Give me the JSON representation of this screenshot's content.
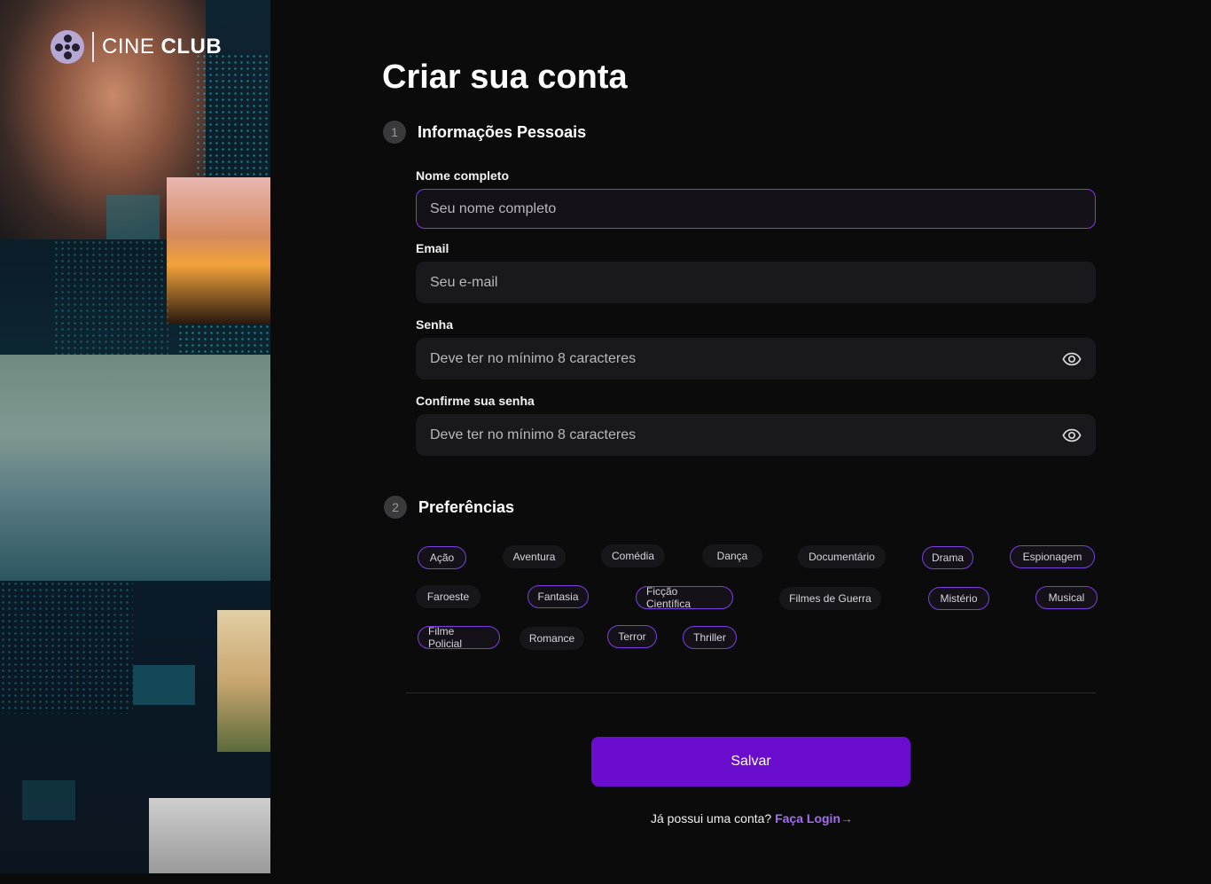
{
  "brand": {
    "light": "CINE",
    "bold": "CLUB"
  },
  "page_title": "Criar sua conta",
  "sections": {
    "personal": {
      "number": "1",
      "title": "Informações Pessoais"
    },
    "preferences": {
      "number": "2",
      "title": "Preferências"
    }
  },
  "fields": {
    "name": {
      "label": "Nome completo",
      "placeholder": "Seu nome completo"
    },
    "email": {
      "label": "Email",
      "placeholder": "Seu e-mail"
    },
    "password": {
      "label": "Senha",
      "placeholder": "Deve ter no mínimo 8 caracteres"
    },
    "confirm": {
      "label": "Confirme sua senha",
      "placeholder": "Deve ter no mínimo 8 caracteres"
    }
  },
  "genres": [
    {
      "label": "Ação",
      "selected": true
    },
    {
      "label": "Aventura",
      "selected": false
    },
    {
      "label": "Comédia",
      "selected": false
    },
    {
      "label": "Dança",
      "selected": false
    },
    {
      "label": "Documentário",
      "selected": false
    },
    {
      "label": "Drama",
      "selected": true
    },
    {
      "label": "Espionagem",
      "selected": true
    },
    {
      "label": "Faroeste",
      "selected": false
    },
    {
      "label": "Fantasia",
      "selected": true
    },
    {
      "label": "Ficção Científica",
      "selected": true
    },
    {
      "label": "Filmes de Guerra",
      "selected": false
    },
    {
      "label": "Mistério",
      "selected": true
    },
    {
      "label": "Musical",
      "selected": true
    },
    {
      "label": "Filme Policial",
      "selected": true
    },
    {
      "label": "Romance",
      "selected": false
    },
    {
      "label": "Terror",
      "selected": true
    },
    {
      "label": "Thriller",
      "selected": true
    }
  ],
  "save_label": "Salvar",
  "login": {
    "prompt": "Já possui uma conta?",
    "link": "Faça Login",
    "arrow": "→"
  },
  "colors": {
    "accent": "#6a0dcf",
    "chip_border": "#7b3fe0",
    "link": "#a46cf0"
  }
}
